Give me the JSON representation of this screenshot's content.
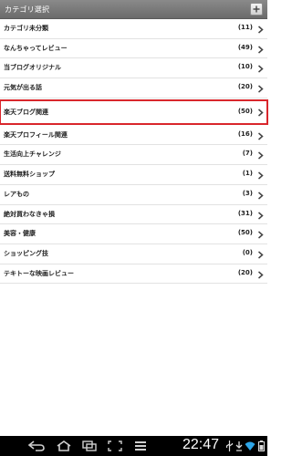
{
  "header": {
    "title": "カテゴリ選択",
    "action_icon": "plus-icon"
  },
  "categories": [
    {
      "label": "カテゴリ未分類",
      "count": "(11)"
    },
    {
      "label": "なんちゃってレビュー",
      "count": "(49)"
    },
    {
      "label": "当ブログオリジナル",
      "count": "(10)"
    },
    {
      "label": "元気が出る話",
      "count": "(20)"
    },
    {
      "label": "楽天ブログ関連",
      "count": "(50)",
      "highlighted": true
    },
    {
      "label": "楽天プロフィール関連",
      "count": "(16)"
    },
    {
      "label": "生活向上チャレンジ",
      "count": "(7)"
    },
    {
      "label": "送料無料ショップ",
      "count": "(1)"
    },
    {
      "label": "レアもの",
      "count": "(3)"
    },
    {
      "label": "絶対買わなきゃ損",
      "count": "(31)"
    },
    {
      "label": "美容・健康",
      "count": "(50)"
    },
    {
      "label": "ショッピング技",
      "count": "(0)"
    },
    {
      "label": "テキトーな映画レビュー",
      "count": "(20)"
    }
  ],
  "statusbar": {
    "time": "22:47",
    "icons": [
      "back-icon",
      "home-icon",
      "recent-apps-icon",
      "screenshot-icon",
      "menu-icon",
      "usb-icon",
      "download-icon",
      "wifi-icon",
      "battery-icon"
    ]
  },
  "colors": {
    "header_bg": "#777777",
    "highlight_border": "#d9262c",
    "navbar_bg": "#000000"
  }
}
